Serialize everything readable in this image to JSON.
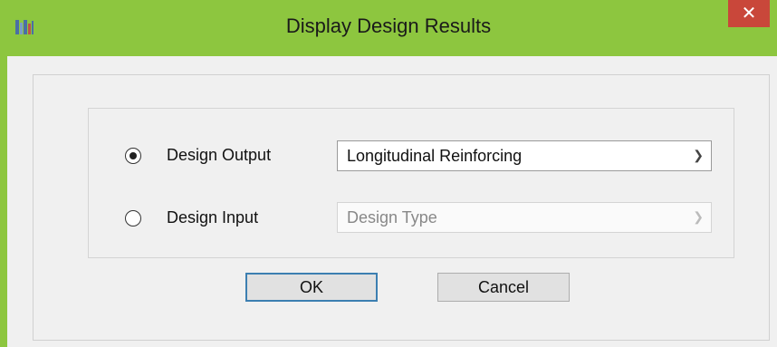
{
  "window": {
    "title": "Display Design Results",
    "close_glyph": "✕"
  },
  "options": [
    {
      "label": "Design Output",
      "selected": true,
      "dropdown_value": "Longitudinal Reinforcing",
      "enabled": true
    },
    {
      "label": "Design Input",
      "selected": false,
      "dropdown_value": "Design Type",
      "enabled": false
    }
  ],
  "buttons": {
    "ok_label": "OK",
    "cancel_label": "Cancel"
  },
  "colors": {
    "titlebar": "#8dc63f",
    "close": "#c9473a",
    "focus_border": "#3c7fb1"
  },
  "icons": {
    "app": "app-icon",
    "close": "close-icon",
    "chevron": "chevron-down-icon"
  }
}
